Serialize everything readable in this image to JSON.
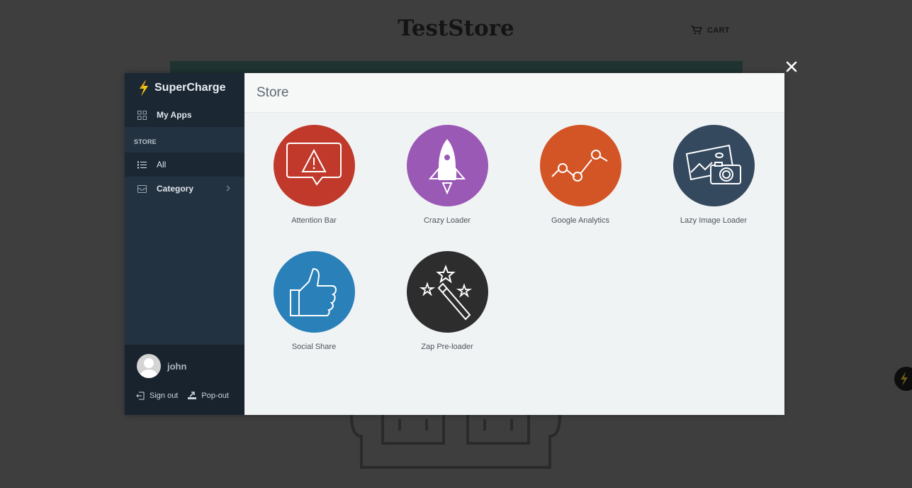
{
  "background": {
    "store_title": "TestStore",
    "cart_label": "CART"
  },
  "modal": {
    "close_icon": "close-icon",
    "sidebar": {
      "brand": "SuperCharge",
      "my_apps": "My Apps",
      "section_store": "STORE",
      "all": "All",
      "category": "Category",
      "user_name": "john",
      "sign_out": "Sign out",
      "pop_out": "Pop-out"
    },
    "main": {
      "title": "Store",
      "apps": [
        {
          "label": "Attention Bar",
          "color": "#c0392b",
          "icon": "alert-icon"
        },
        {
          "label": "Crazy Loader",
          "color": "#9b59b6",
          "icon": "rocket-icon"
        },
        {
          "label": "Google Analytics",
          "color": "#d35424",
          "icon": "line-chart-icon"
        },
        {
          "label": "Lazy Image Loader",
          "color": "#34495e",
          "icon": "photo-camera-icon"
        },
        {
          "label": "Social Share",
          "color": "#2a80b9",
          "icon": "thumbs-up-icon"
        },
        {
          "label": "Zap Pre-loader",
          "color": "#2d2d2d",
          "icon": "magic-wand-icon"
        }
      ]
    }
  }
}
